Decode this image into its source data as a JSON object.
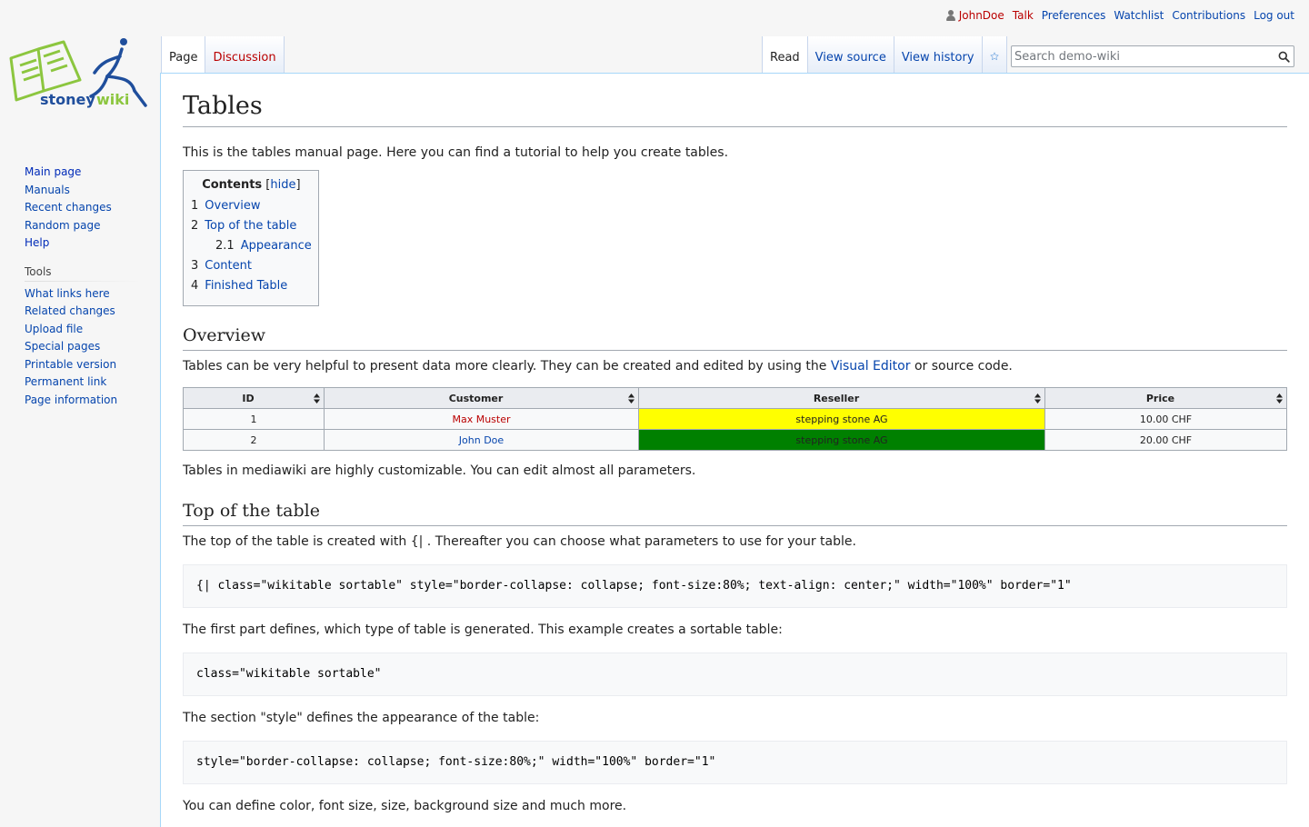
{
  "personal": {
    "username": "JohnDoe",
    "talk": "Talk",
    "preferences": "Preferences",
    "watchlist": "Watchlist",
    "contributions": "Contributions",
    "logout": "Log out"
  },
  "logo": {
    "text_a": "stoney",
    "text_b": "wiki"
  },
  "navigation": {
    "items": [
      "Main page",
      "Manuals",
      "Recent changes",
      "Random page",
      "Help"
    ]
  },
  "tools": {
    "heading": "Tools",
    "items": [
      "What links here",
      "Related changes",
      "Upload file",
      "Special pages",
      "Printable version",
      "Permanent link",
      "Page information"
    ]
  },
  "tabs": {
    "left": [
      "Page",
      "Discussion"
    ],
    "right": [
      "Read",
      "View source",
      "View history"
    ]
  },
  "search": {
    "placeholder": "Search demo-wiki"
  },
  "page": {
    "title": "Tables",
    "intro": "This is the tables manual page. Here you can find a tutorial to help you create tables.",
    "toc": {
      "title": "Contents",
      "hide_open": "[",
      "hide": "hide",
      "hide_close": "]",
      "items": [
        {
          "num": "1",
          "label": "Overview"
        },
        {
          "num": "2",
          "label": "Top of the table"
        },
        {
          "num": "2.1",
          "label": "Appearance"
        },
        {
          "num": "3",
          "label": "Content"
        },
        {
          "num": "4",
          "label": "Finished Table"
        }
      ]
    },
    "overview": {
      "heading": "Overview",
      "text_before": "Tables can be very helpful to present data more clearly. They can be created and edited by using the ",
      "link": "Visual Editor",
      "text_after": " or source code.",
      "after_table": "Tables in mediawiki are highly customizable. You can edit almost all parameters."
    },
    "table": {
      "headers": [
        "ID",
        "Customer",
        "Reseller",
        "Price"
      ],
      "rows": [
        {
          "id": "1",
          "customer": "Max Muster",
          "reseller": "stepping stone AG",
          "price": "10.00 CHF",
          "customer_color": "#ba0000",
          "reseller_bg": "#ffff00"
        },
        {
          "id": "2",
          "customer": "John Doe",
          "reseller": "stepping stone AG",
          "price": "20.00 CHF",
          "customer_color": "#0645ad",
          "reseller_bg": "#008000"
        }
      ]
    },
    "top": {
      "heading": "Top of the table",
      "text": "The top of the table is created with {| . Thereafter you can choose what parameters to use for your table.",
      "code1": "{| class=\"wikitable sortable\" style=\"border-collapse: collapse; font-size:80%; text-align: center;\" width=\"100%\" border=\"1\"",
      "text2": "The first part defines, which type of table is generated. This example creates a sortable table:",
      "code2": "class=\"wikitable sortable\"",
      "text3": "The section \"style\" defines the appearance of the table:",
      "code3": "style=\"border-collapse: collapse; font-size:80%;\" width=\"100%\" border=\"1\"",
      "text4": "You can define color, font size, size, background size and much more."
    }
  }
}
